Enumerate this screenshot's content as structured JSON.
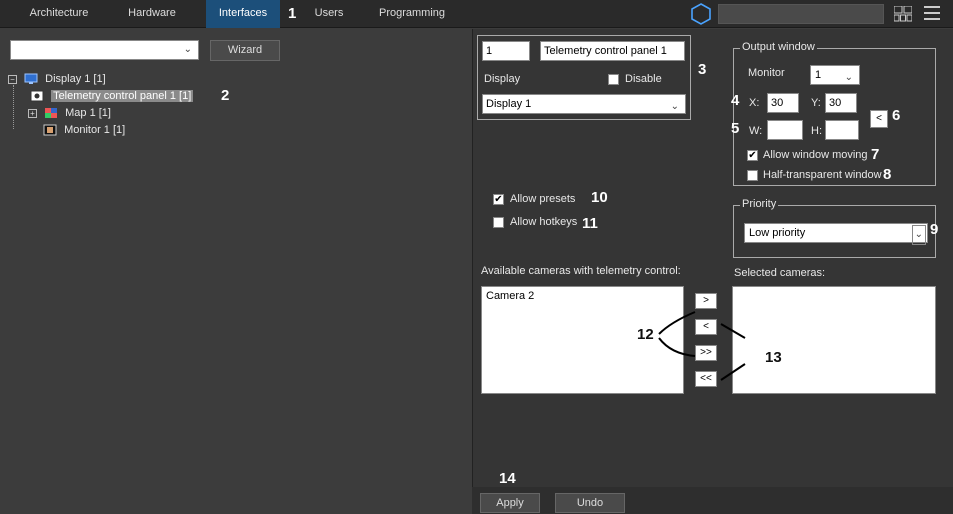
{
  "tabs": [
    {
      "label": "Architecture",
      "active": false
    },
    {
      "label": "Hardware",
      "active": false
    },
    {
      "label": "Interfaces",
      "active": true
    },
    {
      "label": "Users",
      "active": false
    },
    {
      "label": "Programming",
      "active": false
    }
  ],
  "left": {
    "combo_value": "",
    "wizard_label": "Wizard",
    "tree": [
      {
        "label": "Display 1 [1]"
      },
      {
        "label": "Telemetry control panel 1 [1]"
      },
      {
        "label": "Map 1 [1]"
      },
      {
        "label": "Monitor 1 [1]"
      }
    ]
  },
  "props": {
    "id_value": "1",
    "name_value": "Telemetry control panel 1",
    "display_label": "Display",
    "disable_label": "Disable",
    "display_select": "Display 1",
    "output_window_title": "Output window",
    "monitor_label": "Monitor",
    "monitor_value": "1",
    "x_label": "X:",
    "x_value": "30",
    "y_label": "Y:",
    "y_value": "30",
    "w_label": "W:",
    "w_value": "",
    "h_label": "H:",
    "h_value": "",
    "reset_label": "<",
    "allow_moving_label": "Allow window moving",
    "half_transparent_label": "Half-transparent window",
    "allow_presets_label": "Allow presets",
    "allow_hotkeys_label": "Allow hotkeys",
    "priority_title": "Priority",
    "priority_value": "Low priority",
    "available_label": "Available cameras with telemetry control:",
    "selected_label": "Selected cameras:",
    "available_items": [
      "Camera 2"
    ],
    "move_right": ">",
    "move_left": "<",
    "move_all_right": ">>",
    "move_all_left": "<<",
    "apply_label": "Apply",
    "undo_label": "Undo"
  },
  "annotations": [
    "1",
    "2",
    "3",
    "4",
    "5",
    "6",
    "7",
    "8",
    "9",
    "10",
    "11",
    "12",
    "13",
    "14"
  ],
  "colors": {
    "active_tab": "#1c4f7a",
    "hex_accent": "#4aa3ff"
  }
}
